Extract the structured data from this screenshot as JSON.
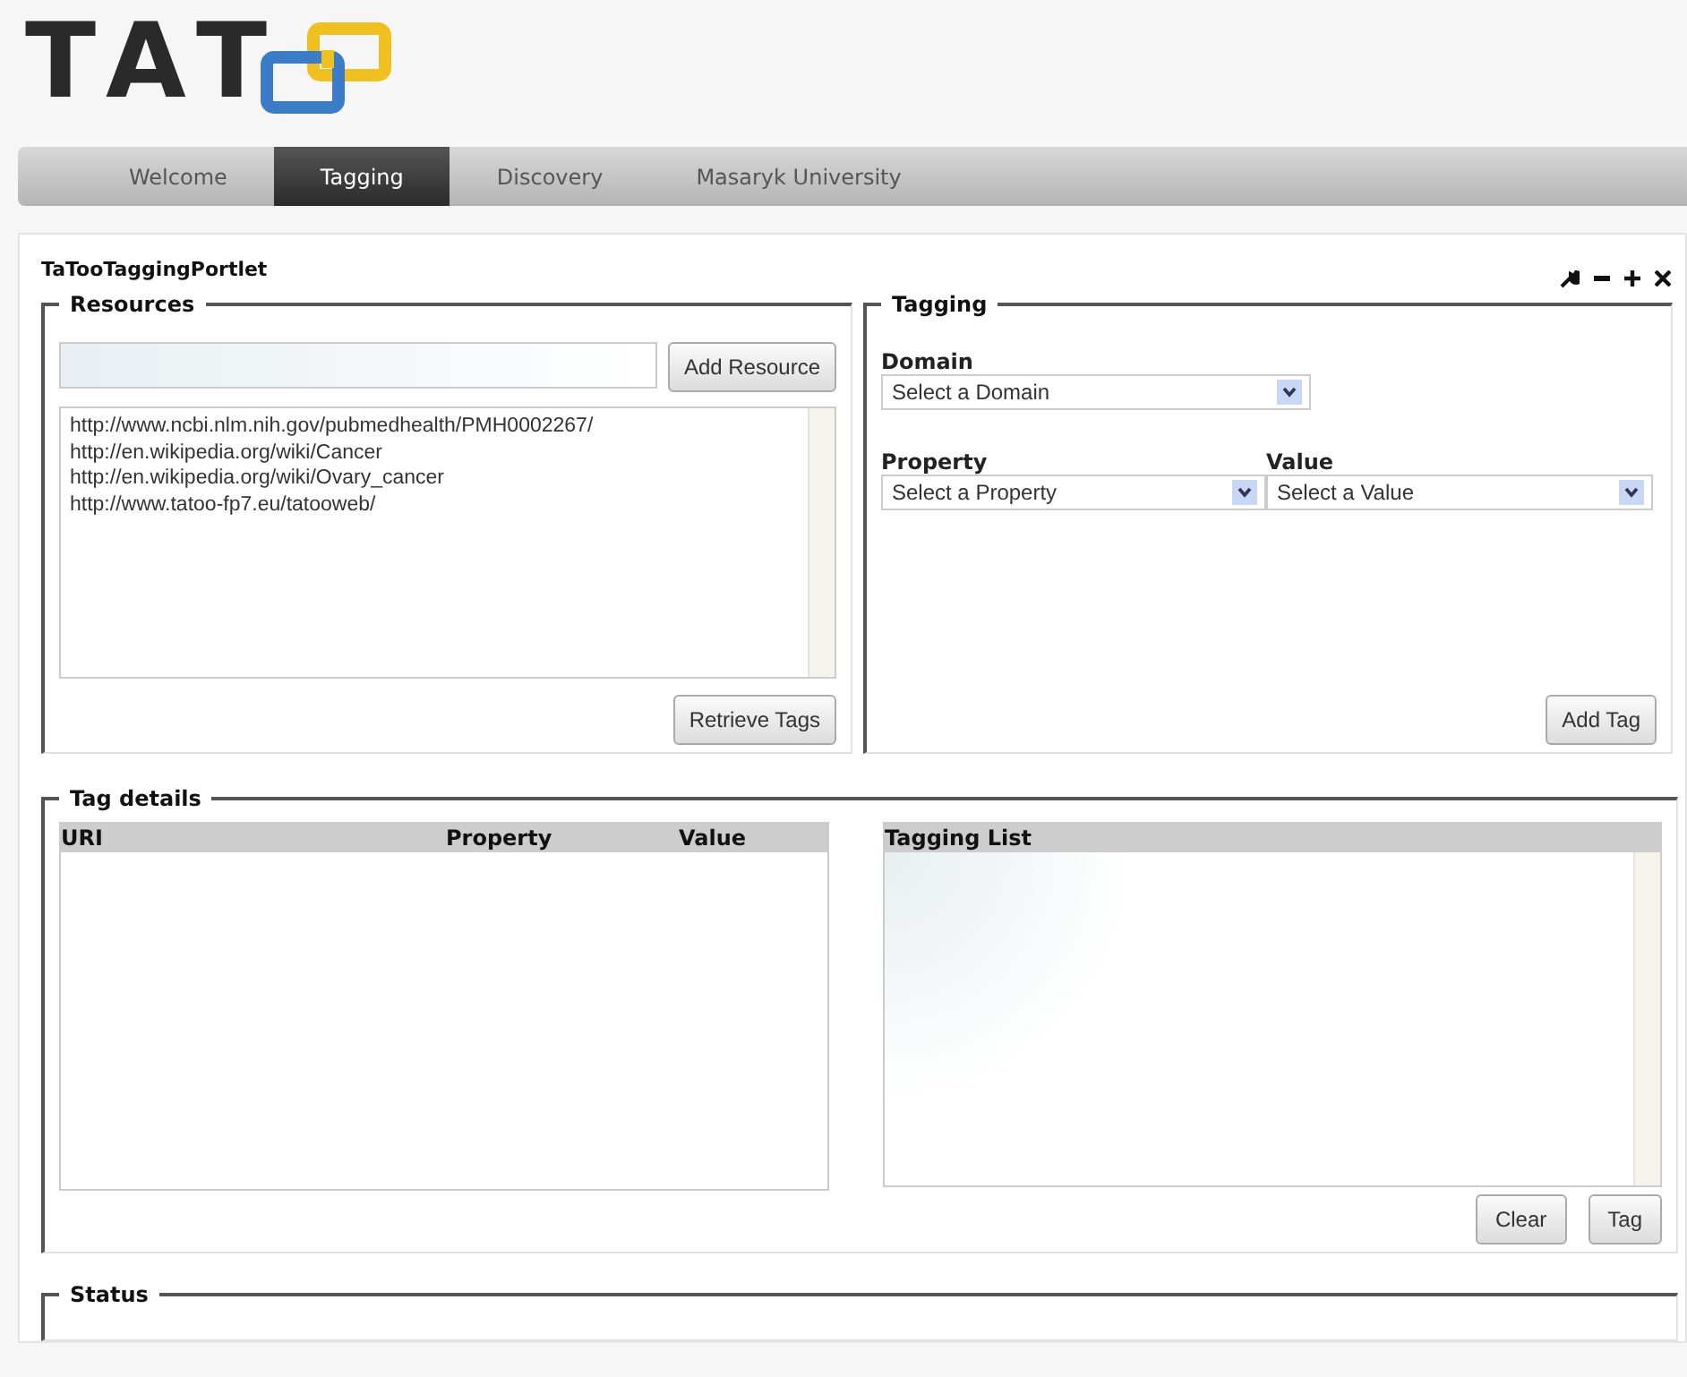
{
  "logo": {
    "text": "TAT"
  },
  "tabs": [
    {
      "label": "Welcome",
      "selected": false
    },
    {
      "label": "Tagging",
      "selected": true
    },
    {
      "label": "Discovery",
      "selected": false
    },
    {
      "label": "Masaryk University",
      "selected": false
    }
  ],
  "portlet": {
    "title": "TaTooTaggingPortlet"
  },
  "resources": {
    "legend": "Resources",
    "add_button": "Add Resource",
    "items": [
      "http://www.ncbi.nlm.nih.gov/pubmedhealth/PMH0002267/",
      "http://en.wikipedia.org/wiki/Cancer",
      "http://en.wikipedia.org/wiki/Ovary_cancer",
      "http://www.tatoo-fp7.eu/tatooweb/"
    ],
    "retrieve_button": "Retrieve Tags"
  },
  "tagging": {
    "legend": "Tagging",
    "domain": {
      "label": "Domain",
      "placeholder": "Select a Domain"
    },
    "property": {
      "label": "Property",
      "placeholder": "Select a Property"
    },
    "value": {
      "label": "Value",
      "placeholder": "Select a Value"
    },
    "add_button": "Add Tag"
  },
  "tag_details": {
    "legend": "Tag details",
    "table": {
      "columns": [
        "URI",
        "Property",
        "Value"
      ]
    },
    "tagging_list": {
      "header": "Tagging List"
    },
    "buttons": [
      "Clear",
      "Tag"
    ]
  },
  "status": {
    "legend": "Status"
  }
}
